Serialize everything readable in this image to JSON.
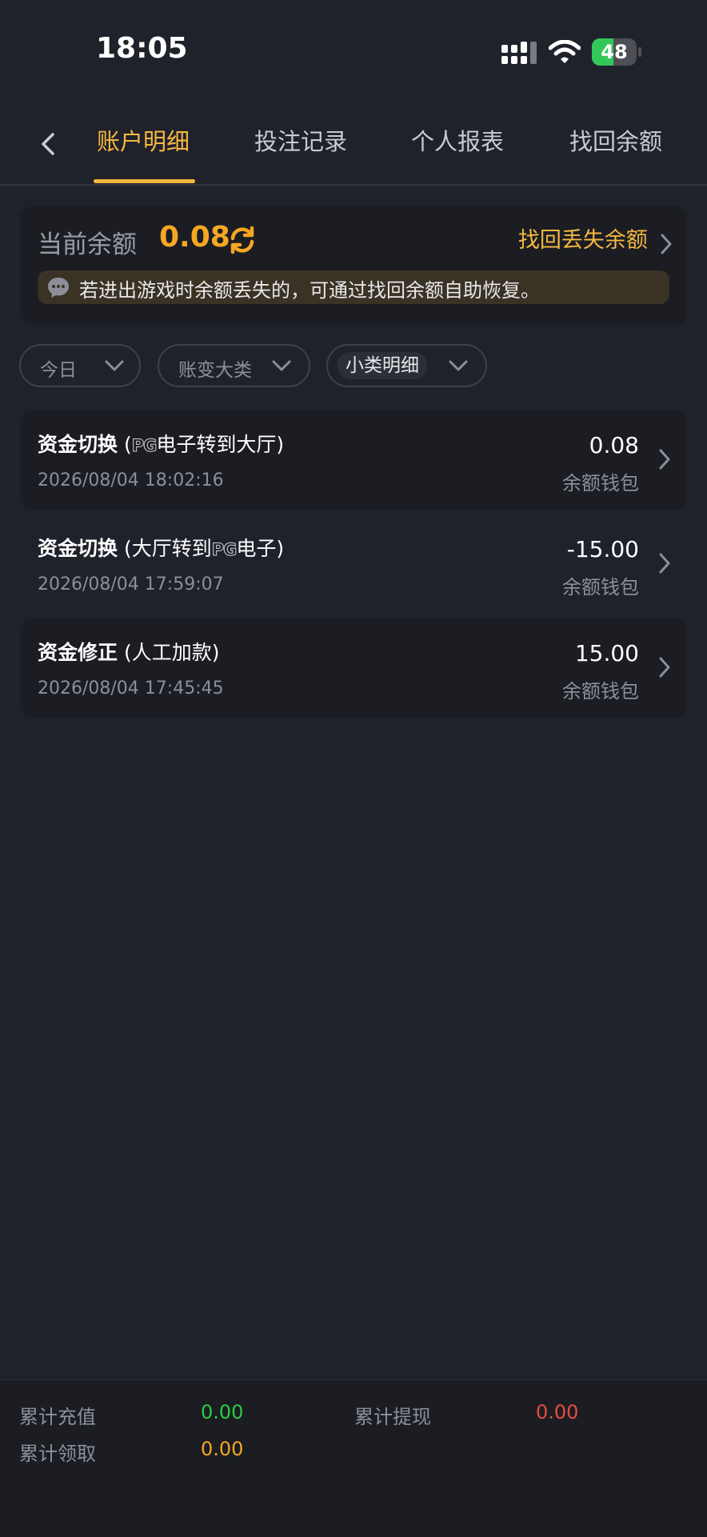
{
  "status_bar": {
    "time": "18:05",
    "battery": "48",
    "battery_level": 0.48
  },
  "nav": {
    "tabs": [
      {
        "label": "账户明细",
        "active": true
      },
      {
        "label": "投注记录",
        "active": false
      },
      {
        "label": "个人报表",
        "active": false
      },
      {
        "label": "找回余额",
        "active": false
      }
    ]
  },
  "balance": {
    "label": "当前余额",
    "value": "0.08",
    "recover_link": "找回丢失余额",
    "notice": "若进出游戏时余额丢失的，可通过找回余额自助恢复。"
  },
  "filters": [
    {
      "label": "今日",
      "selected": false
    },
    {
      "label": "账变大类",
      "selected": false
    },
    {
      "label": "小类明细",
      "selected": true
    }
  ],
  "records": [
    {
      "type": "资金切换",
      "detail_before": " (",
      "logo": "PG",
      "detail_after": "电子转到大厅)",
      "time": "2026/08/04 18:02:16",
      "amount": "0.08",
      "wallet": "余额钱包"
    },
    {
      "type": "资金切换",
      "detail_before": " (大厅转到",
      "logo": "PG",
      "detail_after": "电子)",
      "time": "2026/08/04 17:59:07",
      "amount": "-15.00",
      "wallet": "余额钱包"
    },
    {
      "type": "资金修正",
      "detail_before": " (人工加款)",
      "logo": "",
      "detail_after": "",
      "time": "2026/08/04 17:45:45",
      "amount": "15.00",
      "wallet": "余额钱包"
    }
  ],
  "footer": {
    "recharge_label": "累计充值",
    "recharge_value": "0.00",
    "withdraw_label": "累计提现",
    "withdraw_value": "0.00",
    "claim_label": "累计领取",
    "claim_value": "0.00"
  },
  "colors": {
    "background": "#20222b",
    "card": "#1b1d23",
    "accent": "#f5b841",
    "balance": "#f5a623",
    "recharge": "#2ecc40",
    "withdraw": "#e74c3c",
    "claim": "#f5a623"
  },
  "icons": [
    "back-chevron-icon",
    "refresh-icon",
    "chevron-right-icon",
    "chat-bubble-icon",
    "chevron-down-icon",
    "signal-icon",
    "wifi-icon",
    "battery-icon"
  ]
}
